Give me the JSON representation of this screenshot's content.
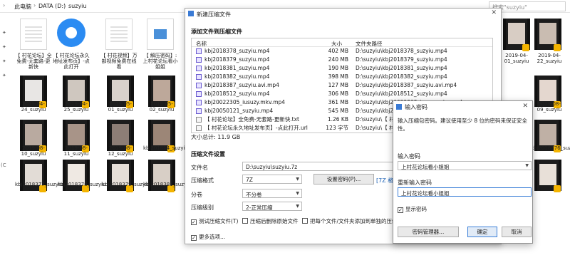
{
  "explorer": {
    "breadcrumb": [
      "此电脑",
      "DATA (D:)",
      "suzyiu"
    ],
    "search_placeholder": "搜索\"suzyiu\"",
    "left_pane_cutoff": "(C",
    "tiles": [
      {
        "label": "【 村花论坛】全免费-无套路-更新快"
      },
      {
        "label": "【 村花论坛永久地址发布页】-点此打开"
      },
      {
        "label": "【 村花视频】万部视频免费在线看"
      },
      {
        "label": "【 解压密码】: 上村花论坛看小姐姐"
      },
      {
        "label": "2019-04-24_suzyiu"
      },
      {
        "label": "2019-04-25_suzyiu"
      },
      {
        "label": "2019-05-01_suzyiu"
      },
      {
        "label": "2019-05-02_suzyiu"
      },
      {
        "label": "2019-08-10_suzyiu"
      },
      {
        "label": "2019-08-11_suzyiu"
      },
      {
        "label": "2019-08-12_suzyiu"
      },
      {
        "label": "kbj201804_suzyiu.avi"
      },
      {
        "label": "kbj2018377_suzyiu"
      },
      {
        "label": "kbj2018378_suzyiu"
      },
      {
        "label": "kbj2018379_suzyiu"
      },
      {
        "label": "kbj2018381_suzyiu"
      },
      {
        "label": "2019-04-01_suzyiu"
      },
      {
        "label": "2019-04-22_suzyiu"
      },
      {
        "label": "2019-08-09_suzyiu"
      },
      {
        "label": "kbj2018376_suzyiu"
      }
    ]
  },
  "new_archive": {
    "title": "新建压缩文件",
    "add_section": "添加文件到压缩文件",
    "col_name": "名称",
    "col_size": "大小",
    "col_path": "文件夹路径",
    "files": [
      {
        "name": "kbj2018378_suzyiu.mp4",
        "size": "402 MB",
        "path": "D:\\suzyiu\\kbj2018378_suzyiu.mp4",
        "icon": "video-file-icon"
      },
      {
        "name": "kbj2018379_suzyiu.mp4",
        "size": "240 MB",
        "path": "D:\\suzyiu\\kbj2018379_suzyiu.mp4",
        "icon": "video-file-icon"
      },
      {
        "name": "kbj2018381_suzyiu.mp4",
        "size": "190 MB",
        "path": "D:\\suzyiu\\kbj2018381_suzyiu.mp4",
        "icon": "video-file-icon"
      },
      {
        "name": "kbj2018382_suzyiu.mp4",
        "size": "398 MB",
        "path": "D:\\suzyiu\\kbj2018382_suzyiu.mp4",
        "icon": "video-file-icon"
      },
      {
        "name": "kbj2018387_suzyiu.avi.mp4",
        "size": "127 MB",
        "path": "D:\\suzyiu\\kbj2018387_suzyiu.avi.mp4",
        "icon": "video-file-icon"
      },
      {
        "name": "kbj2018512_suzyiu.mp4",
        "size": "306 MB",
        "path": "D:\\suzyiu\\kbj2018512_suzyiu.mp4",
        "icon": "video-file-icon"
      },
      {
        "name": "kbj20022305_iusuzy.mkv.mp4",
        "size": "361 MB",
        "path": "D:\\suzyiu\\kbj20022305_iusuzy.mkv.mp4",
        "icon": "video-file-icon"
      },
      {
        "name": "kbj20050121_suzyiu.mp4",
        "size": "545 MB",
        "path": "D:\\suzyiu\\kbj2005",
        "icon": "video-file-icon"
      },
      {
        "name": "【 村花论坛】全免费-无套路-更新快.txt",
        "size": "1.26 KB",
        "path": "D:\\suzyiu\\【 村花论",
        "icon": "text-file-icon"
      },
      {
        "name": "【 村花论坛永久地址发布页】-点此打开.url",
        "size": "123 字节",
        "path": "D:\\suzyiu\\【 村花论",
        "icon": "url-file-icon"
      }
    ],
    "total_size": "大小总计: 11.9 GB",
    "settings_section": "压缩文件设置",
    "filename_label": "文件名",
    "filename_value": "D:\\suzyiu\\suzyiu.7z",
    "format_label": "压缩格式",
    "format_value": "7Z",
    "set_password_button": "设置密码(P)...",
    "format_link": "[7Z 格式",
    "split_label": "分卷",
    "split_value": "不分卷",
    "level_label": "压缩级别",
    "level_value": "2-正常压缩",
    "test_archive": "测试压缩文件(T)",
    "delete_after": "压缩后删除原始文件",
    "each_file": "把每个文件/文件夹添加到单独的压缩文件",
    "more_options": "更多选项..."
  },
  "password_dialog": {
    "title": "输入密码",
    "hint": "输入压缩包密码。建议使用至少 8 位的密码来保证安全性。",
    "enter_label": "输入密码",
    "enter_value": "上村花论坛看小姐姐",
    "reenter_label": "重新输入密码",
    "reenter_value": "上村花论坛看小姐姐",
    "show_password": "显示密码",
    "manager_button": "密码管理器...",
    "ok_button": "确定",
    "cancel_button": "取消"
  }
}
